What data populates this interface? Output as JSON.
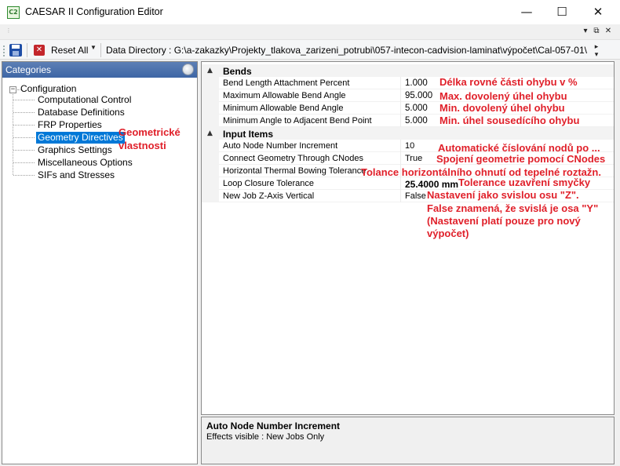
{
  "window": {
    "title": "CAESAR II Configuration Editor",
    "icon_text": "C2",
    "minimize_glyph": "—",
    "maximize_glyph": "☐",
    "close_glyph": "✕"
  },
  "mdi": {
    "pin_glyph": "▾",
    "restore_glyph": "⧉",
    "close_glyph": "✕"
  },
  "toolbar": {
    "reset_label": "Reset All",
    "data_directory": "Data Directory : G:\\a-zakazky\\Projekty_tlakova_zarizeni_potrubi\\057-intecon-cadvision-laminat\\výpočet\\Cal-057-01\\",
    "icons": {
      "save": "save-icon",
      "reset": "reset-icon"
    }
  },
  "categories": {
    "header": "Categories",
    "root": "Configuration",
    "items": [
      {
        "label": "Computational Control",
        "selected": false
      },
      {
        "label": "Database Definitions",
        "selected": false
      },
      {
        "label": "FRP Properties",
        "selected": false
      },
      {
        "label": "Geometry Directives",
        "selected": true
      },
      {
        "label": "Graphics Settings",
        "selected": false
      },
      {
        "label": "Miscellaneous Options",
        "selected": false
      },
      {
        "label": "SIFs and Stresses",
        "selected": false
      }
    ],
    "annotation_line1": "Geometrické",
    "annotation_line2": "vlastnosti"
  },
  "properties": {
    "sections": [
      {
        "title": "Bends",
        "rows": [
          {
            "name": "Bend Length Attachment Percent",
            "value": "1.000",
            "note": "Délka rovné části ohybu v %"
          },
          {
            "name": "Maximum Allowable Bend Angle",
            "value": "95.000",
            "note": "Max. dovolený úhel ohybu"
          },
          {
            "name": "Minimum Allowable Bend Angle",
            "value": "5.000",
            "note": "Min. dovolený úhel ohybu"
          },
          {
            "name": "Minimum Angle to Adjacent Bend Point",
            "value": "5.000",
            "note": "Min. úhel sousedícího ohybu"
          }
        ]
      },
      {
        "title": "Input Items",
        "rows": [
          {
            "name": "Auto Node Number Increment",
            "value": "10",
            "note": "Automatické číslování nodů po ..."
          },
          {
            "name": "Connect Geometry Through CNodes",
            "value": "True",
            "note": "Spojení geometrie pomocí CNodes"
          },
          {
            "name": "Horizontal Thermal Bowing Tolerance",
            "value": "",
            "note": "Tolance horizontálního ohnutí od tepelné roztažn."
          },
          {
            "name": "Loop Closure Tolerance",
            "value": "25.4000 mm",
            "note": "Tolerance uzavření smyčky"
          },
          {
            "name": "New Job Z-Axis Vertical",
            "value": "False",
            "note": "Nastavení jako svislou osu \"Z\"."
          }
        ]
      }
    ],
    "extra_notes": [
      "False znamená, že svislá je osa \"Y\"",
      "(Nastavení platí pouze pro nový",
      "výpočet)"
    ]
  },
  "description": {
    "title": "Auto Node Number Increment",
    "text": "Effects visible : New Jobs Only"
  }
}
